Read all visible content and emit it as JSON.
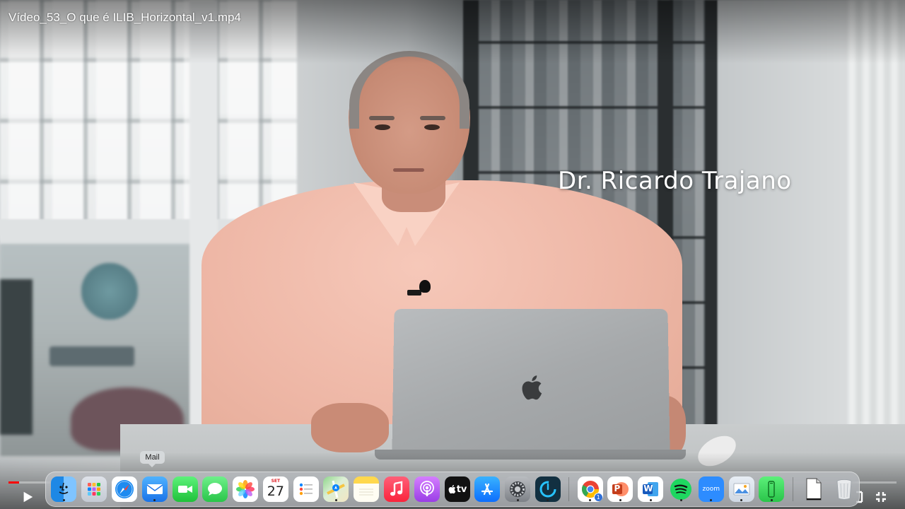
{
  "window": {
    "title": "Vídeo_53_O que é ILIB_Horizontal_v1.mp4"
  },
  "video": {
    "lower_third_name": "Dr. Ricardo Trajano",
    "progress_fraction": 0.012,
    "controls": {
      "play_icon": "play-icon",
      "fullscreen_exit_icon": "exit-fullscreen-icon"
    }
  },
  "dock": {
    "tooltip": "Mail",
    "calendar": {
      "month": "SET",
      "day": "27"
    },
    "chrome_badge": "1",
    "zoom_label": "zoom",
    "word_letter": "W",
    "powerpoint_letter": "P",
    "appletv_label": "tv"
  },
  "colors": {
    "progress": "#ff0000",
    "dock_background": "#cdd2d7"
  }
}
